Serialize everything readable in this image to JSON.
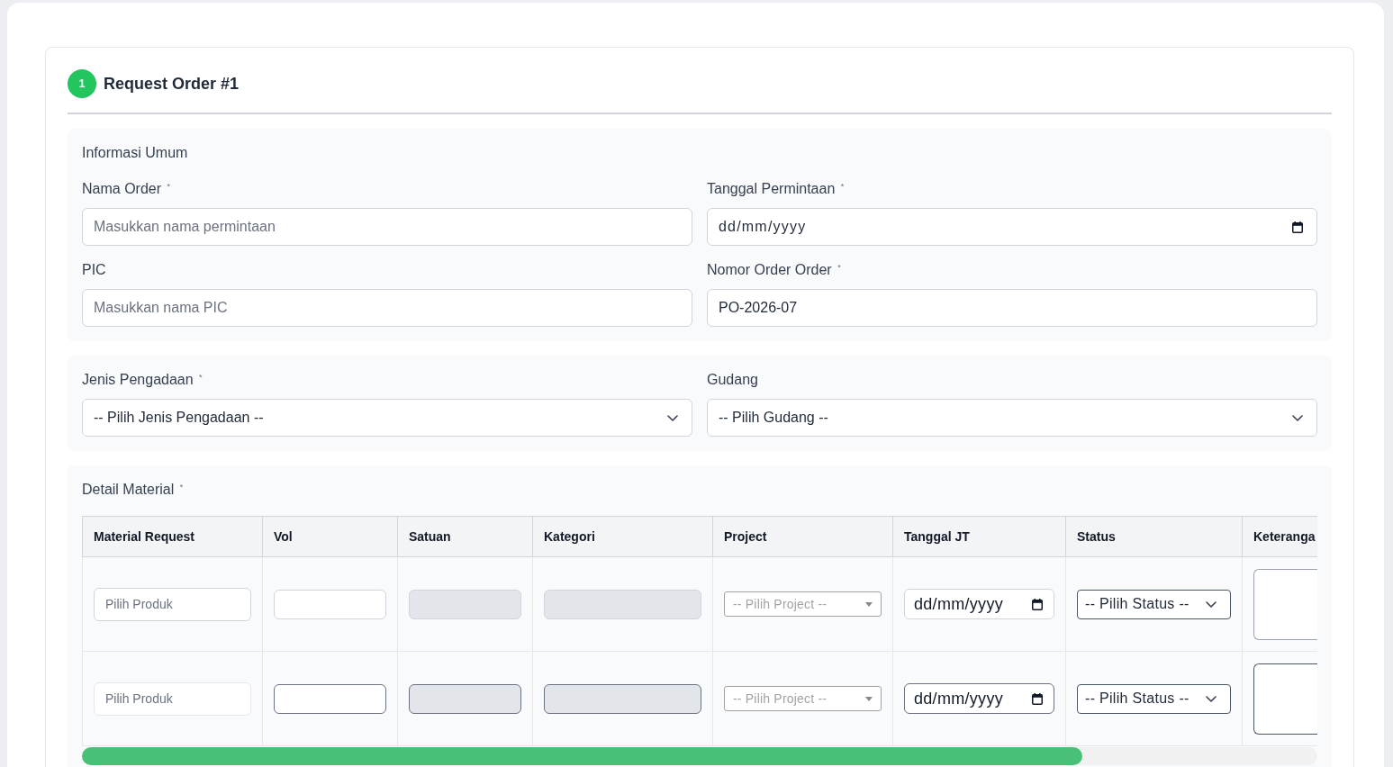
{
  "form": {
    "step": "1",
    "title": "Request Order #1"
  },
  "sections": [
    {
      "kind": "fields",
      "title": "Informasi Umum",
      "fields": [
        {
          "kind": "text",
          "label": "Nama Order $^{*}$",
          "placeholder": "Masukkan nama permintaan"
        },
        {
          "kind": "date",
          "label": "Tanggal Permintaan $^{*}$",
          "placeholder": "dd/mm/yyyy"
        },
        {
          "kind": "text",
          "label": "PIC",
          "placeholder": "Masukkan nama PIC"
        },
        {
          "kind": "text",
          "label": "Nomor Order Order $^{*}$",
          "value": "PO-2026-07"
        }
      ]
    },
    {
      "kind": "fields",
      "fields": [
        {
          "kind": "select",
          "label": "Jenis Pengadaan $^{*}$",
          "value": "-- Pilih Jenis Pengadaan --"
        },
        {
          "kind": "select",
          "label": "Gudang",
          "value": "-- Pilih Gudang --"
        }
      ]
    },
    {
      "kind": "table",
      "title": "Detail Material $^{*}$",
      "table": {
        "columns": [
          "Material Request",
          "Vol",
          "Satuan",
          "Kategori",
          "Project",
          "Tanggal JT",
          "Status",
          "Keteranga"
        ],
        "rows": [
          {
            "kind": "styled",
            "cells": [
              {
                "kind": "text",
                "placeholder": "Pilih Produk"
              },
              {
                "kind": "input",
                "disabled": false
              },
              {
                "kind": "input",
                "disabled": true
              },
              {
                "kind": "input",
                "disabled": true
              },
              {
                "kind": "combo",
                "placeholder": "-- Pilih Project --"
              },
              {
                "kind": "date",
                "placeholder": "dd/mm/yyyy"
              },
              {
                "kind": "select",
                "value": "-- Pilih Status --"
              },
              {
                "kind": "textarea"
              }
            ]
          },
          {
            "kind": "plain",
            "cells": [
              {
                "kind": "text",
                "placeholder": "Pilih Produk"
              },
              {
                "kind": "input",
                "disabled": false
              },
              {
                "kind": "input",
                "disabled": true
              },
              {
                "kind": "input",
                "disabled": true
              },
              {
                "kind": "combo",
                "placeholder": "-- Pilih Project --"
              },
              {
                "kind": "date",
                "placeholder": "dd/mm/yyyy"
              },
              {
                "kind": "select",
                "value": "-- Pilih Status --"
              },
              {
                "kind": "textarea"
              }
            ]
          }
        ]
      }
    }
  ]
}
